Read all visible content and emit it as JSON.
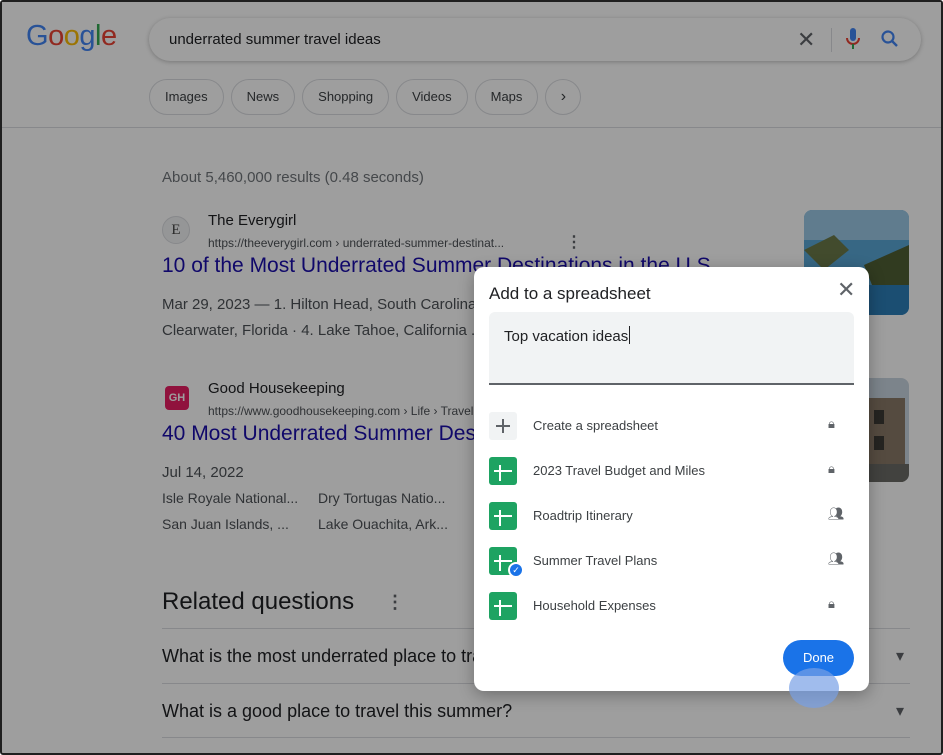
{
  "header": {
    "logo": [
      "G",
      "o",
      "o",
      "g",
      "l",
      "e"
    ],
    "logo_colors": [
      "#4285f4",
      "#ea4335",
      "#fbbc05",
      "#4285f4",
      "#34a853",
      "#ea4335"
    ],
    "query": "underrated summer travel ideas",
    "clear_glyph": "✕",
    "chips": [
      "Images",
      "News",
      "Shopping",
      "Videos",
      "Maps"
    ],
    "chip_more": "›"
  },
  "results": {
    "stats": "About 5,460,000 results (0.48 seconds)",
    "items": [
      {
        "icon_text": "E",
        "site_name": "The Everygirl",
        "url": "https://theeverygirl.com › underrated-summer-destinat...",
        "title": "10 of the Most Underrated Summer Destinations in the U.S.",
        "line1": "Mar 29, 2023 — 1. Hilton Head, South Carolina · 2. ...",
        "line2": "Clearwater, Florida · 4. Lake Tahoe, California ..."
      },
      {
        "icon_text": "GH",
        "site_name": "Good Housekeeping",
        "url": "https://www.goodhousekeeping.com › Life › Travel",
        "title": "40 Most Underrated Summer Destinations",
        "line1": "Jul 14, 2022",
        "line2a": "Isle Royale National...",
        "line2b": "Dry Tortugas Natio...",
        "line3a": "San Juan Islands, ...",
        "line3b": "Lake Ouachita, Ark..."
      }
    ]
  },
  "related": {
    "heading": "Related questions",
    "questions": [
      "What is the most underrated place to travel?",
      "What is a good place to travel this summer?"
    ]
  },
  "dialog": {
    "title": "Add to a spreadsheet",
    "close_glyph": "✕",
    "input_value": "Top vacation ideas",
    "items": [
      {
        "label": "Create a spreadsheet",
        "access": "private",
        "type": "create"
      },
      {
        "label": "2023 Travel Budget and Miles",
        "access": "private",
        "type": "sheet"
      },
      {
        "label": "Roadtrip Itinerary",
        "access": "shared",
        "type": "sheet"
      },
      {
        "label": "Summer Travel Plans",
        "access": "shared",
        "type": "sheet",
        "selected": true
      },
      {
        "label": "Household Expenses",
        "access": "private",
        "type": "sheet"
      }
    ],
    "done_label": "Done"
  },
  "colors": {
    "link": "#1a0dab",
    "sheets_green": "#1ea362",
    "accent_blue": "#1a73e8"
  }
}
